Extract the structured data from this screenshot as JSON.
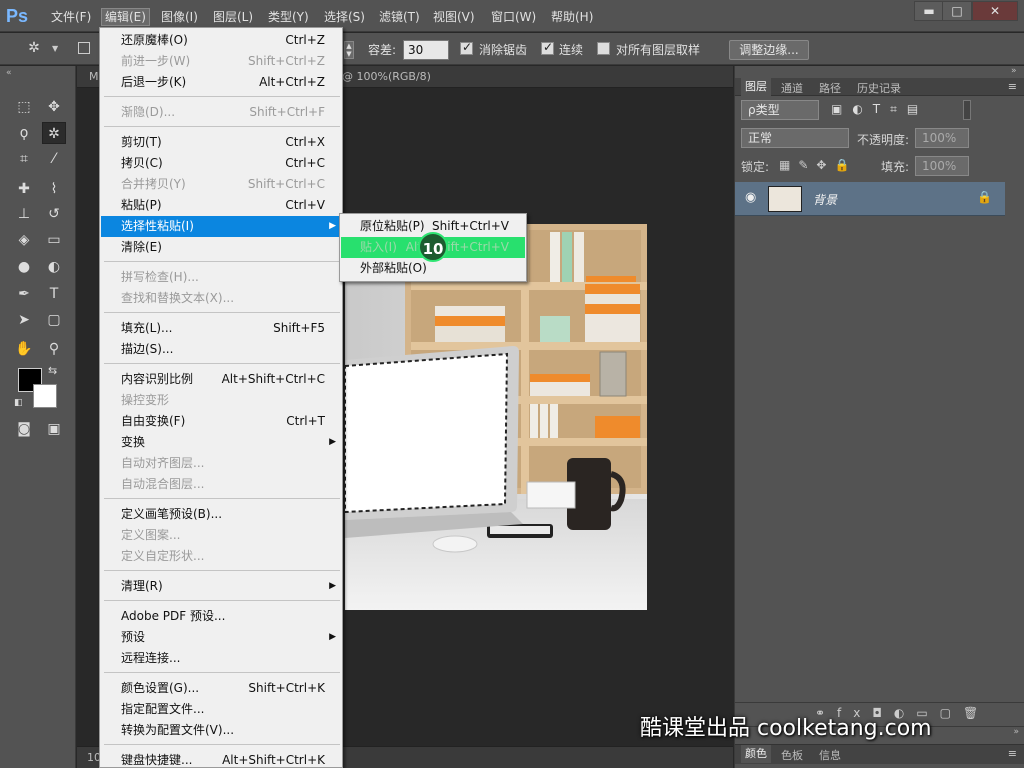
{
  "app": {
    "logo": "Ps"
  },
  "menubar": {
    "items": [
      "文件(F)",
      "编辑(E)",
      "图像(I)",
      "图层(L)",
      "类型(Y)",
      "选择(S)",
      "滤镜(T)",
      "视图(V)",
      "窗口(W)",
      "帮助(H)"
    ],
    "active": "编辑(E)"
  },
  "window_controls": {
    "minimize": "▬",
    "maximize": "□",
    "close": "✕"
  },
  "options": {
    "tolerance_label": "容差:",
    "tolerance_value": "30",
    "anti_alias_label": "消除锯齿",
    "anti_alias_checked": true,
    "contiguous_label": "连续",
    "contiguous_checked": true,
    "sample_all_label": "对所有图层取样",
    "sample_all_checked": false,
    "refine_edge_label": "调整边缘..."
  },
  "document": {
    "tab_title_partial": "@ 100%(RGB/8)",
    "tab_prefix": "M",
    "status_zoom": "10"
  },
  "edit_menu": {
    "items": [
      {
        "label": "还原魔棒(O)",
        "shortcut": "Ctrl+Z",
        "enabled": true
      },
      {
        "label": "前进一步(W)",
        "shortcut": "Shift+Ctrl+Z",
        "enabled": false
      },
      {
        "label": "后退一步(K)",
        "shortcut": "Alt+Ctrl+Z",
        "enabled": true
      },
      {
        "label": "渐隐(D)...",
        "shortcut": "Shift+Ctrl+F",
        "enabled": false
      },
      {
        "label": "剪切(T)",
        "shortcut": "Ctrl+X",
        "enabled": true
      },
      {
        "label": "拷贝(C)",
        "shortcut": "Ctrl+C",
        "enabled": true
      },
      {
        "label": "合并拷贝(Y)",
        "shortcut": "Shift+Ctrl+C",
        "enabled": false
      },
      {
        "label": "粘贴(P)",
        "shortcut": "Ctrl+V",
        "enabled": true
      },
      {
        "label": "选择性粘贴(I)",
        "shortcut": "",
        "enabled": true,
        "highlighted": true,
        "submenu": true
      },
      {
        "label": "清除(E)",
        "shortcut": "",
        "enabled": true
      },
      {
        "label": "拼写检查(H)...",
        "shortcut": "",
        "enabled": false
      },
      {
        "label": "查找和替换文本(X)...",
        "shortcut": "",
        "enabled": false
      },
      {
        "label": "填充(L)...",
        "shortcut": "Shift+F5",
        "enabled": true
      },
      {
        "label": "描边(S)...",
        "shortcut": "",
        "enabled": true
      },
      {
        "label": "内容识别比例",
        "shortcut": "Alt+Shift+Ctrl+C",
        "enabled": true
      },
      {
        "label": "操控变形",
        "shortcut": "",
        "enabled": false
      },
      {
        "label": "自由变换(F)",
        "shortcut": "Ctrl+T",
        "enabled": true
      },
      {
        "label": "变换",
        "shortcut": "",
        "enabled": true,
        "submenu": true
      },
      {
        "label": "自动对齐图层...",
        "shortcut": "",
        "enabled": false
      },
      {
        "label": "自动混合图层...",
        "shortcut": "",
        "enabled": false
      },
      {
        "label": "定义画笔预设(B)...",
        "shortcut": "",
        "enabled": true
      },
      {
        "label": "定义图案...",
        "shortcut": "",
        "enabled": false
      },
      {
        "label": "定义自定形状...",
        "shortcut": "",
        "enabled": false
      },
      {
        "label": "清理(R)",
        "shortcut": "",
        "enabled": true,
        "submenu": true
      },
      {
        "label": "Adobe PDF 预设...",
        "shortcut": "",
        "enabled": true
      },
      {
        "label": "预设",
        "shortcut": "",
        "enabled": true,
        "submenu": true
      },
      {
        "label": "远程连接...",
        "shortcut": "",
        "enabled": true
      },
      {
        "label": "颜色设置(G)...",
        "shortcut": "Shift+Ctrl+K",
        "enabled": true
      },
      {
        "label": "指定配置文件...",
        "shortcut": "",
        "enabled": true
      },
      {
        "label": "转换为配置文件(V)...",
        "shortcut": "",
        "enabled": true
      },
      {
        "label": "键盘快捷键...",
        "shortcut": "Alt+Shift+Ctrl+K",
        "enabled": true
      }
    ]
  },
  "paste_special_menu": {
    "items": [
      {
        "label": "原位粘贴(P)",
        "shortcut": "Shift+Ctrl+V"
      },
      {
        "label": "贴入(I)",
        "shortcut": "Alt+Shift+Ctrl+V",
        "highlighted": true
      },
      {
        "label": "外部粘贴(O)",
        "shortcut": ""
      }
    ]
  },
  "step_badge": "10",
  "layers_panel": {
    "tabs": [
      "图层",
      "通道",
      "路径",
      "历史记录"
    ],
    "active_tab": "图层",
    "filter_label": "ρ类型",
    "blend_mode": "正常",
    "opacity_label": "不透明度:",
    "opacity_value": "100%",
    "lock_label": "锁定:",
    "fill_label": "填充:",
    "fill_value": "100%",
    "layers": [
      {
        "name": "背景",
        "locked": true,
        "visible": true
      }
    ]
  },
  "bottom_panel": {
    "tabs": [
      "颜色",
      "色板",
      "信息"
    ]
  },
  "watermark": "酷课堂出品 coolketang.com",
  "colors": {
    "highlight": "#0b86e0",
    "green": "#28e06e",
    "layer_selected": "#5d7287"
  }
}
